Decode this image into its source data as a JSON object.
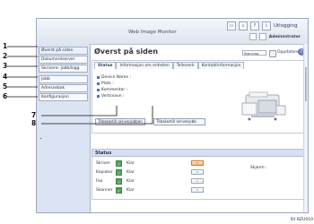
{
  "window": {
    "title": "Web Image Monitor",
    "toolbar_icons": [
      "monitor-icon",
      "search-icon",
      "help-icon",
      "info-icon"
    ],
    "logout_label": "Utlogging",
    "user_label": "Administrator"
  },
  "sidebar": {
    "items": [
      {
        "label": "Øverst på siden"
      },
      {
        "label": "Dokumentserver"
      },
      {
        "label": "Skrivere- jobb/logg"
      },
      {
        "label": "Jobb"
      },
      {
        "label": "Adressebok"
      },
      {
        "label": "Konfigurasjon"
      }
    ]
  },
  "main": {
    "title": "Øverst på siden",
    "refresh_option": "Skanning",
    "refresh_label": "Oppdatere",
    "tabs": [
      {
        "label": "Status"
      },
      {
        "label": "Informasjon om enheten"
      },
      {
        "label": "Telleverk"
      },
      {
        "label": "Kontaktinformasjon"
      }
    ],
    "info_fields": [
      {
        "label": "Device Name :"
      },
      {
        "label": "Plats :"
      },
      {
        "label": "Kommentar :"
      },
      {
        "label": "Vertsnavn :"
      }
    ],
    "buttons": {
      "reset_printer": "Tilbakestill skriverjobben",
      "reset_device": "Tilbakestill skriverjobb"
    },
    "status_section": {
      "title": "Status",
      "screen_label": "Skjerm :",
      "rows": [
        {
          "label": "Skriver",
          "value": "Klar",
          "arrow": "orange"
        },
        {
          "label": "Kopiator",
          "value": "Klar",
          "arrow": "white"
        },
        {
          "label": "Fax",
          "value": "Klar",
          "arrow": "white"
        },
        {
          "label": "Skanner",
          "value": "Klar",
          "arrow": "white"
        }
      ]
    }
  },
  "callouts": {
    "labels": [
      "1",
      "2",
      "3",
      "4",
      "5",
      "6",
      "7",
      "8"
    ]
  },
  "caption": "SV BZU010"
}
